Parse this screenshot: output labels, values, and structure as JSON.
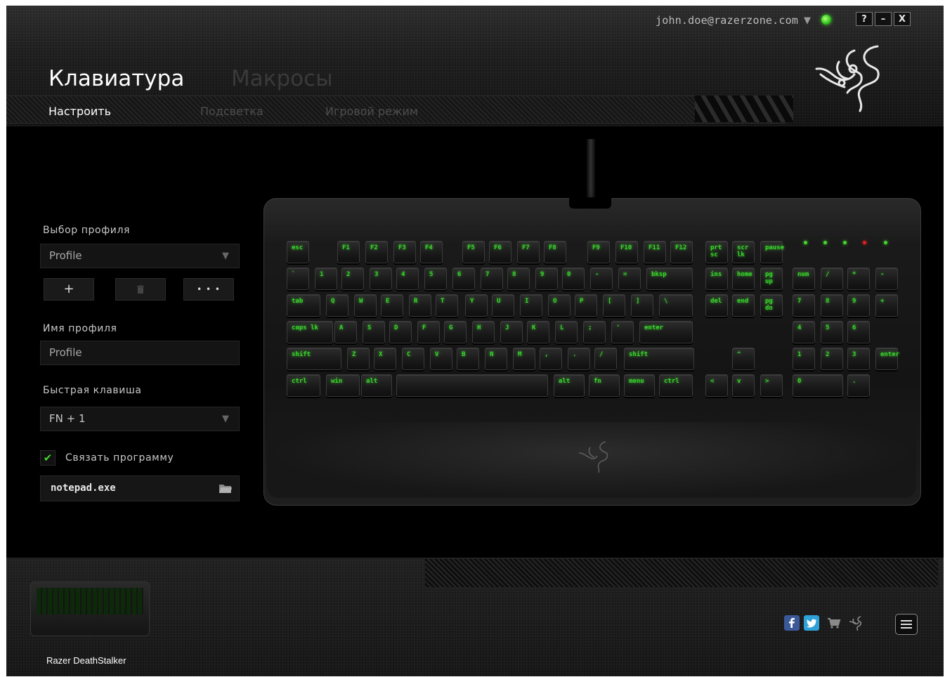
{
  "account": {
    "email": "john.doe@razerzone.com"
  },
  "window_buttons": {
    "help": "?",
    "minimize": "–",
    "close": "X"
  },
  "header": {
    "title": "Клавиатура",
    "secondary_tab": "Макросы",
    "subtabs": [
      {
        "label": "Настроить",
        "active": true
      },
      {
        "label": "Подсветка",
        "active": false
      },
      {
        "label": "Игровой режим",
        "active": false
      }
    ]
  },
  "profile_panel": {
    "select_label": "Выбор профиля",
    "selected_profile": "Profile",
    "buttons": {
      "add": "+",
      "delete": "🗑",
      "more": "• • •"
    },
    "name_label": "Имя профиля",
    "name_value": "Profile",
    "hotkey_label": "Быстрая клавиша",
    "hotkey_value": "FN + 1",
    "link_program_label": "Связать программу",
    "link_program_checked": true,
    "program_value": "notepad.exe"
  },
  "keyboard": {
    "rows": [
      [
        "esc",
        "F1",
        "F2",
        "F3",
        "F4",
        "F5",
        "F6",
        "F7",
        "F8",
        "F9",
        "F10",
        "F11",
        "F12",
        "prt sc",
        "scr lk",
        "pause"
      ],
      [
        "`",
        "1",
        "2",
        "3",
        "4",
        "5",
        "6",
        "7",
        "8",
        "9",
        "0",
        "-",
        "=",
        "bksp",
        "ins",
        "home",
        "pg up",
        "num",
        "/",
        "*",
        "-"
      ],
      [
        "tab",
        "Q",
        "W",
        "E",
        "R",
        "T",
        "Y",
        "U",
        "I",
        "O",
        "P",
        "[",
        "]",
        "\\",
        "del",
        "end",
        "pg dn",
        "7",
        "8",
        "9",
        "+"
      ],
      [
        "caps lk",
        "A",
        "S",
        "D",
        "F",
        "G",
        "H",
        "J",
        "K",
        "L",
        ";",
        "'",
        "enter",
        "4",
        "5",
        "6"
      ],
      [
        "shift",
        "Z",
        "X",
        "C",
        "V",
        "B",
        "N",
        "M",
        ",",
        ".",
        "/",
        "shift",
        "^",
        "1",
        "2",
        "3",
        "enter"
      ],
      [
        "ctrl",
        "win",
        "alt",
        "",
        "alt",
        "fn",
        "menu",
        "ctrl",
        "<",
        "v",
        ">",
        "0",
        "."
      ]
    ]
  },
  "device": {
    "name": "Razer DeathStalker"
  },
  "footer_icons": [
    "facebook-icon",
    "twitter-icon",
    "store-icon",
    "razer-icon",
    "menu-icon"
  ],
  "colors": {
    "accent": "#44d62c",
    "background": "#000000",
    "led_red": "#e02020"
  }
}
